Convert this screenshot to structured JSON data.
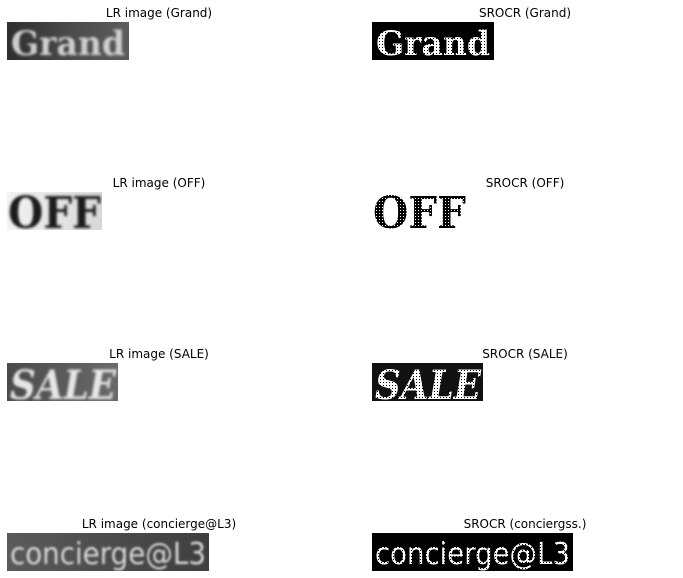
{
  "panels": [
    {
      "lr_caption": "LR image (Grand)",
      "sr_caption": "SROCR (Grand)",
      "word": "Grand"
    },
    {
      "lr_caption": "LR image (OFF)",
      "sr_caption": "SROCR (OFF)",
      "word": "OFF"
    },
    {
      "lr_caption": "LR image (SALE)",
      "sr_caption": "SROCR (SALE)",
      "word": "SALE"
    },
    {
      "lr_caption": "LR image (concierge@L3)",
      "sr_caption": "SROCR (conciergss.)",
      "word": "concierge@L3"
    }
  ],
  "colors": {
    "lr_dark_bg": "#3a3a3a",
    "lr_light_text": "#c8c8c8",
    "sr_bg": "#000000",
    "sr_text": "#ffffff"
  }
}
